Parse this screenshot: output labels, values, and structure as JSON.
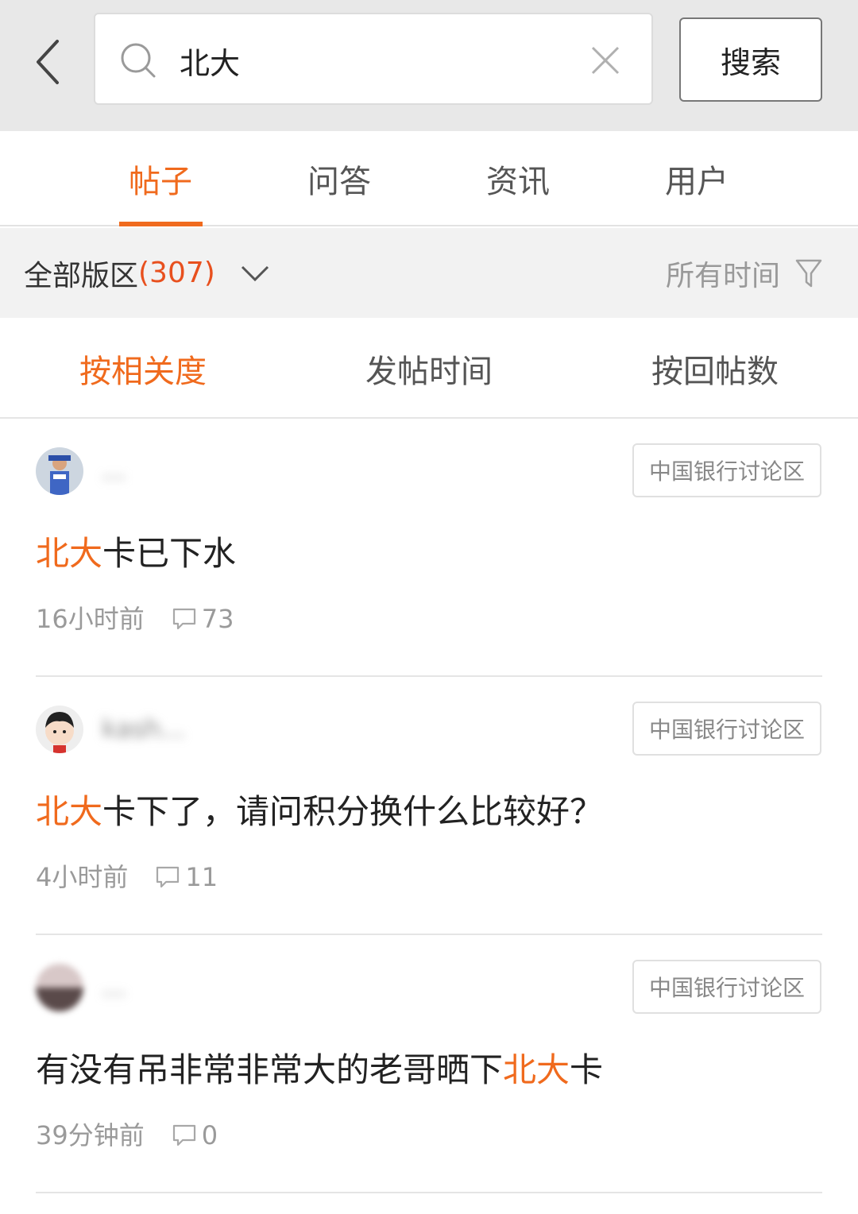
{
  "search": {
    "query": "北大",
    "button_label": "搜索"
  },
  "tabs": [
    {
      "label": "帖子",
      "active": true
    },
    {
      "label": "问答",
      "active": false
    },
    {
      "label": "资讯",
      "active": false
    },
    {
      "label": "用户",
      "active": false
    }
  ],
  "filter": {
    "board_label": "全部版区",
    "board_count": "(307)",
    "time_label": "所有时间"
  },
  "sort": [
    {
      "label": "按相关度",
      "active": true
    },
    {
      "label": "发帖时间",
      "active": false
    },
    {
      "label": "按回帖数",
      "active": false
    }
  ],
  "posts": [
    {
      "username": "...",
      "board": "中国银行讨论区",
      "title_highlight": "北大",
      "title_prefix": "",
      "title_rest": "卡已下水",
      "time": "16小时前",
      "replies": "73"
    },
    {
      "username": "kash...",
      "board": "中国银行讨论区",
      "title_highlight": "北大",
      "title_prefix": "",
      "title_rest": "卡下了，请问积分换什么比较好？",
      "time": "4小时前",
      "replies": "11"
    },
    {
      "username": "...",
      "board": "中国银行讨论区",
      "title_prefix": "有没有吊非常非常大的老哥晒下",
      "title_highlight": "北大",
      "title_rest": "卡",
      "time": "39分钟前",
      "replies": "0"
    }
  ],
  "colors": {
    "accent": "#f06a1d",
    "count": "#e8501e",
    "topbar_bg": "#e8e8e8",
    "filter_bg": "#f2f2f2"
  }
}
